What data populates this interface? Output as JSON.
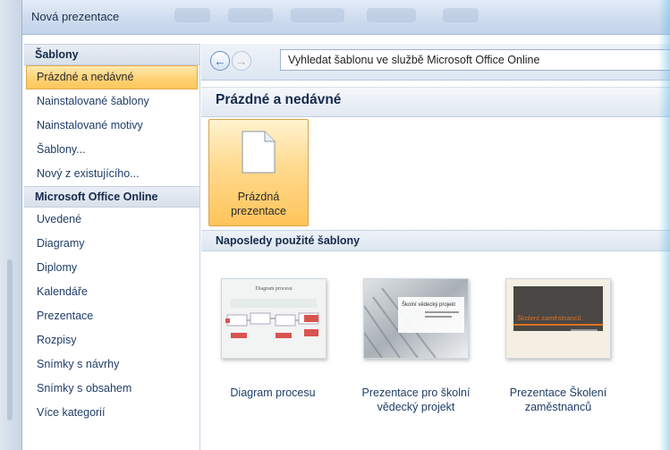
{
  "window": {
    "title": "Nová prezentace"
  },
  "sidebar": {
    "sections": [
      {
        "header": "Šablony",
        "items": [
          {
            "label": "Prázdné a nedávné",
            "selected": true
          },
          {
            "label": "Nainstalované šablony"
          },
          {
            "label": "Nainstalované motivy"
          },
          {
            "label": "Šablony..."
          },
          {
            "label": "Nový z existujícího..."
          }
        ]
      },
      {
        "header": "Microsoft Office Online",
        "items": [
          {
            "label": "Uvedené"
          },
          {
            "label": "Diagramy"
          },
          {
            "label": "Diplomy"
          },
          {
            "label": "Kalendáře"
          },
          {
            "label": "Prezentace"
          },
          {
            "label": "Rozpisy"
          },
          {
            "label": "Snímky s návrhy"
          },
          {
            "label": "Snímky s obsahem"
          },
          {
            "label": "Více kategorií"
          }
        ]
      }
    ]
  },
  "main": {
    "search": {
      "value": "Vyhledat šablonu ve službě Microsoft Office Online"
    },
    "section_title": "Prázdné a nedávné",
    "blank": {
      "label": "Prázdná\nprezentace"
    },
    "recent_header": "Naposledy použité šablony",
    "templates": [
      {
        "label": "Diagram procesu",
        "thumb_title": "Diagram procesu"
      },
      {
        "label": "Prezentace pro školní vědecký projekt",
        "thumb_title": "Školní vědecký projekt"
      },
      {
        "label": "Prezentace Školení zaměstnanců",
        "thumb_title": "Školení zaměstnanců"
      }
    ]
  },
  "colors": {
    "selected_bg": "#ffd37a",
    "accent_text": "#1f3d68",
    "thumb3_title": "#e07020"
  }
}
